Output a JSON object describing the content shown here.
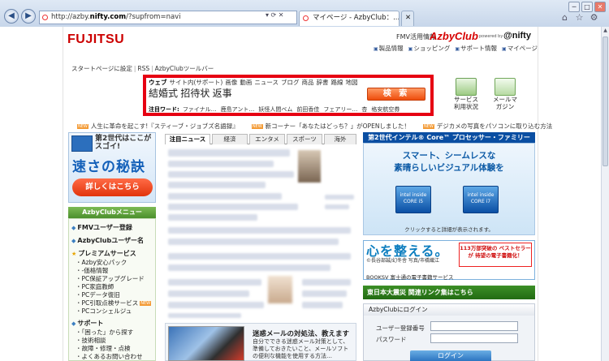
{
  "browser": {
    "window_controls": [
      "─",
      "□",
      "✕"
    ],
    "back": "◀",
    "forward": "▶",
    "url_prefix": "http://azby.",
    "url_domain": "nifty.com",
    "url_suffix": "/?supfrom=navi",
    "address_controls": "▾ ⟳ ✕",
    "tab_active": "マイページ - AzbyClub：...",
    "tab_close": "✕",
    "tools": [
      "⌂",
      "☆",
      "⚙"
    ]
  },
  "header": {
    "logo": "FUJITSU",
    "fmv_label": "FMV活用情報",
    "azby_logo": "AzbyClub",
    "powered_by": "powered by",
    "nifty_logo": "@nifty",
    "top_links": [
      "製品情報",
      "ショッピング",
      "サポート情報",
      "マイページ"
    ],
    "sub_links": [
      "スタートページに設定",
      "RSS",
      "AzbyClubツールバー"
    ]
  },
  "search": {
    "tabs": [
      "ウェブ",
      "サイト内(サポート)",
      "画像",
      "動画",
      "ニュース",
      "ブログ",
      "商品",
      "辞書",
      "路線",
      "地図"
    ],
    "query": "結婚式 招待状 返事",
    "button": "検 索",
    "hot_label": "注目ワード:",
    "hot_words": [
      "ファイナル…",
      "鹿島アント…",
      "妖怪人間ベム",
      "前田香佳",
      "フェアリー…",
      "杏",
      "格安航空券"
    ]
  },
  "side_icons": {
    "service_label": "サービス利用状況",
    "mail_label": "メールマガジン"
  },
  "ticker": [
    "人生に革命を起こす!『スティーブ・ジョブズ名語録』",
    "新コーナー「あなたはどっち？」がOPENしました！",
    "デジカメの写真をパソコンに取り込む方法"
  ],
  "promo": {
    "line1": "第2世代はここがスゴイ!",
    "line2": "速さの秘訣",
    "button": "詳しくはこちら"
  },
  "menu": {
    "title": "AzbyClubメニュー",
    "items": [
      {
        "label": "FMVユーザー登録",
        "cls": "major"
      },
      {
        "label": "AzbyClubユーザー名",
        "cls": "major"
      },
      {
        "label": "プレミアムサービス",
        "cls": "major star"
      },
      {
        "label": "Azby安心パック",
        "cls": "sub"
      },
      {
        "label": "-価格情報",
        "cls": "sub"
      },
      {
        "label": "PC保証アップグレード",
        "cls": "sub"
      },
      {
        "label": "PC家庭教師",
        "cls": "sub"
      },
      {
        "label": "PCデータ復旧",
        "cls": "sub"
      },
      {
        "label": "PC引取点検サービス",
        "cls": "sub new"
      },
      {
        "label": "PCコンシェルジュ",
        "cls": "sub"
      },
      {
        "label": "サポート",
        "cls": "major"
      },
      {
        "label": "「困った」から探す",
        "cls": "sub"
      },
      {
        "label": "技術相談",
        "cls": "sub"
      },
      {
        "label": "故障・修理・点検",
        "cls": "sub"
      },
      {
        "label": "よくあるお問い合わせ",
        "cls": "sub"
      }
    ]
  },
  "center": {
    "tabs": [
      "注目ニュース",
      "経済",
      "エンタメ",
      "スポーツ",
      "海外"
    ],
    "spam_title": "迷惑メールの対処法、教えます",
    "spam_text": "自分でできる迷惑メール対策として、準備しておきたいこと、メールソフトの便利な機能を使用する方法…"
  },
  "intel": {
    "header": "第2世代インテル® Core™ プロセッサー・ファミリー",
    "line1": "スマート、シームレスな",
    "line2": "素晴らしいビジュアル体験を",
    "logo1": "intel inside CORE i5",
    "logo2": "intel inside CORE i7",
    "note": "クリックすると詳細が表示されます。"
  },
  "kokoro": {
    "title": "心を整える。",
    "sub": "©長谷部誠/幻冬舎 写真/市橋織江",
    "badge": "113万部突破の ベストセラーが 待望の電子書籍化！",
    "booksv": "BOOKSV 富士通の電子書籍サービス"
  },
  "earthquake": "東日本大震災 関連リンク集はこちら",
  "login": {
    "title": "AzbyClubにログイン",
    "user_label": "ユーザー登録番号",
    "pass_label": "パスワード",
    "button": "ログイン"
  },
  "colors": {
    "accent_red": "#e60012",
    "azby_blue": "#0c5aa6",
    "menu_green": "#4b8f2c"
  }
}
